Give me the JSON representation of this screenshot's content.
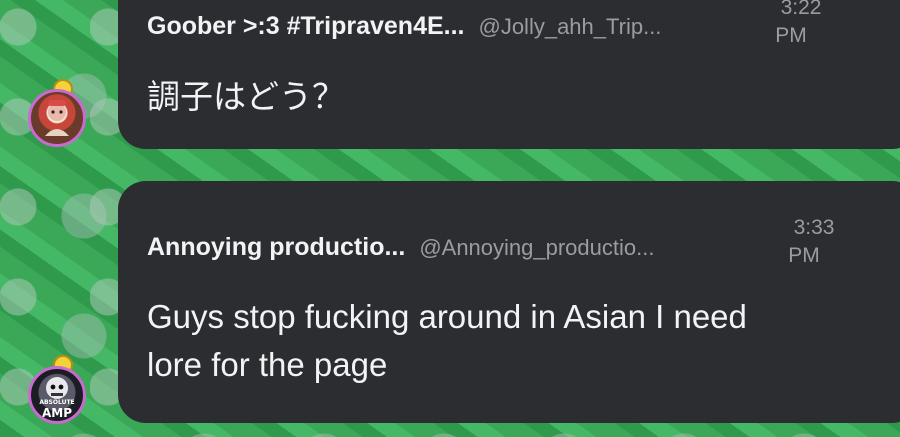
{
  "messages": [
    {
      "author": "Goober >:3 #Tripraven4E...",
      "handle": "@Jolly_ahh_Trip...",
      "time_line1": "3:22",
      "time_line2": "PM",
      "text": "調子はどう？"
    },
    {
      "author": "Annoying productio...",
      "handle": "@Annoying_productio...",
      "time_line1": "3:33",
      "time_line2": "PM",
      "text_line1": "Guys stop fucking around in Asian I need",
      "text_line2": "lore for the page",
      "avatar_label1": "ABSOLUTE",
      "avatar_label2": "AMP"
    }
  ],
  "colors": {
    "bubble": "#2b2d31",
    "background": "#3aa857",
    "avatar_ring": "#c86acf",
    "muted_text": "#9a9ca2"
  }
}
